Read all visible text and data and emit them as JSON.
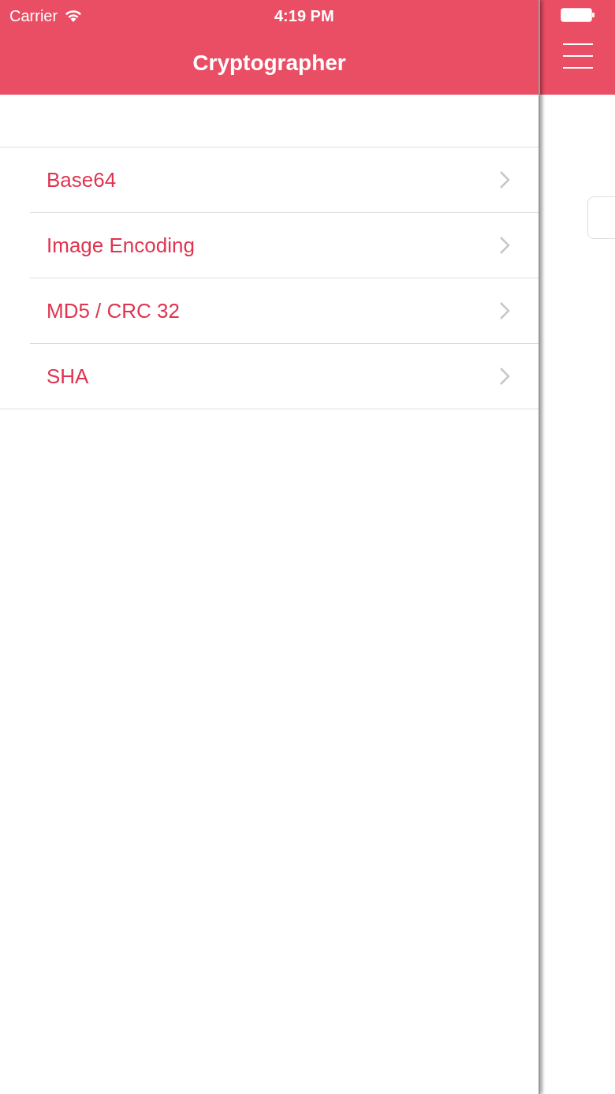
{
  "status_bar": {
    "carrier": "Carrier",
    "time": "4:19 PM"
  },
  "nav_bar": {
    "title": "Cryptographer"
  },
  "menu_items": [
    {
      "label": "Base64"
    },
    {
      "label": "Image Encoding"
    },
    {
      "label": "MD5 / CRC 32"
    },
    {
      "label": "SHA"
    }
  ]
}
